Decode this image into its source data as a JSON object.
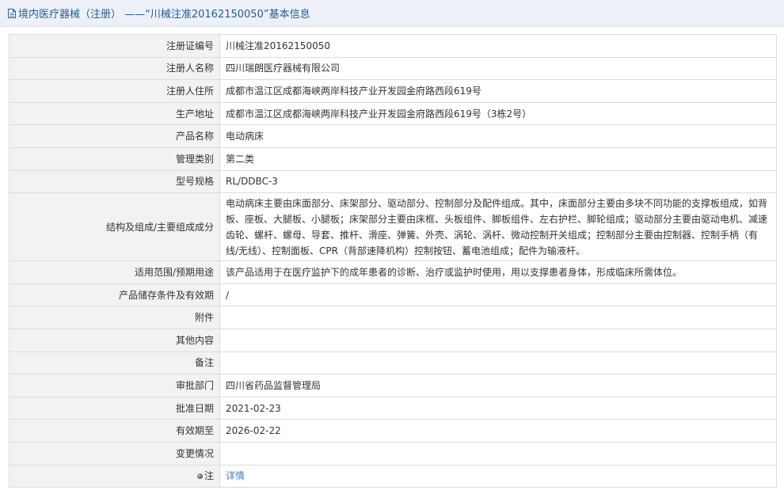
{
  "header": {
    "icon": "document-icon",
    "title": "境内医疗器械（注册） ——“川械注准20162150050”基本信息"
  },
  "fields": [
    {
      "label": "注册证编号",
      "value": "川械注准20162150050"
    },
    {
      "label": "注册人名称",
      "value": "四川瑞朗医疗器械有限公司"
    },
    {
      "label": "注册人住所",
      "value": "成都市温江区成都海峡两岸科技产业开发园金府路西段619号"
    },
    {
      "label": "生产地址",
      "value": "成都市温江区成都海峡两岸科技产业开发园金府路西段619号（3栋2号）"
    },
    {
      "label": "产品名称",
      "value": "电动病床"
    },
    {
      "label": "管理类别",
      "value": "第二类"
    },
    {
      "label": "型号规格",
      "value": "RL/DDBC-3"
    },
    {
      "label": "结构及组成/主要组成成分",
      "value": "电动病床主要由床面部分、床架部分、驱动部分、控制部分及配件组成。其中，床面部分主要由多块不同功能的支撑板组成，如背板、座板、大腿板、小腿板；床架部分主要由床框、头板组件、脚板组件、左右护栏、脚轮组成；驱动部分主要由驱动电机、减速齿轮、螺杆、螺母、导套、推杆、滑座、弹簧、外壳、涡轮、涡杆、微动控制开关组成；控制部分主要由控制器、控制手柄（有线/无线）、控制面板、CPR（背部速降机构）控制按钮、蓄电池组成；配件为输液杆。"
    },
    {
      "label": "适用范围/预期用途",
      "value": "该产品适用于在医疗监护下的成年患者的诊断、治疗或监护时使用，用以支撑患者身体，形成临床所需体位。"
    },
    {
      "label": "产品储存条件及有效期",
      "value": "/"
    },
    {
      "label": "附件",
      "value": ""
    },
    {
      "label": "其他内容",
      "value": ""
    },
    {
      "label": "备注",
      "value": ""
    },
    {
      "label": "审批部门",
      "value": "四川省药品监督管理局"
    },
    {
      "label": "批准日期",
      "value": "2021-02-23"
    },
    {
      "label": "有效期至",
      "value": "2026-02-22"
    },
    {
      "label": "变更情况",
      "value": ""
    }
  ],
  "note": {
    "icon": "bullet-icon",
    "label": "注",
    "link_text": "详情"
  }
}
